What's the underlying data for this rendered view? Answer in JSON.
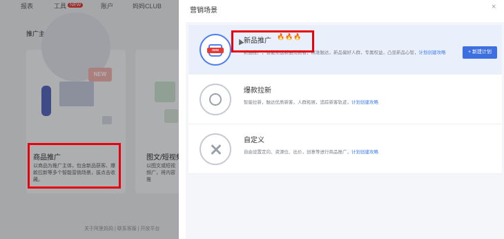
{
  "topnav": {
    "items": [
      "报表",
      "工具",
      "账户",
      "妈妈CLUB"
    ],
    "new_badge": "NEW"
  },
  "left": {
    "section_title": "推广主体",
    "card1": {
      "illustration_badge": "NEW",
      "title": "商品推广",
      "desc": "以商品为推广主体，包含新品获客、爆款拉新等多个智能营销场景，拔点击收藏。"
    },
    "card2": {
      "title": "图文/短视频",
      "desc": "以图文或短视频广，将内容推"
    },
    "footer_links": [
      "关于阿里妈妈",
      "联系客服",
      "开放平台"
    ]
  },
  "drawer": {
    "title": "营销场景",
    "close": "×",
    "scenes": [
      {
        "name": "新品推广",
        "flames": "🔥🔥🔥",
        "desc": "新品推广，智能筛选新品消费者，精准触达，新品偏好人群，专属权益，凸显新品心智，",
        "link": "计划创建攻略",
        "icon_badge": "new",
        "button": "+ 新建计划"
      },
      {
        "name": "爆款拉新",
        "desc": "智能拉新，触达优质新客，人群拓展，追踪新客轨迹，",
        "link": "计划创建攻略"
      },
      {
        "name": "自定义",
        "desc": "自由设置定向、资源位、出价，创意等进行商品推广，",
        "link": "计划创建攻略"
      }
    ]
  },
  "colors": {
    "accent": "#3d6fe0",
    "annotation": "#e8000c",
    "link": "#3d7cf2"
  }
}
